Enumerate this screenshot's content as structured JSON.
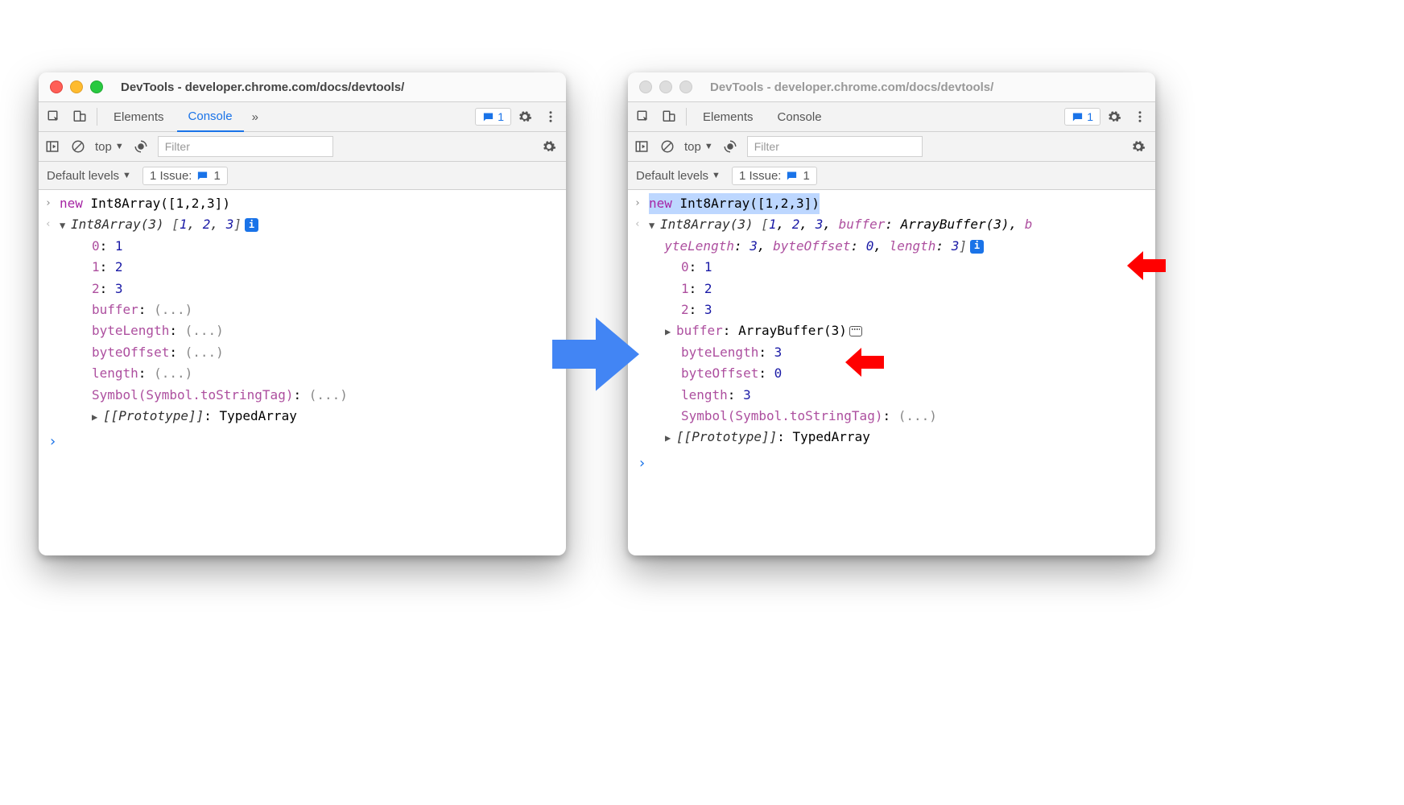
{
  "title": "DevTools - developer.chrome.com/docs/devtools/",
  "tabs": {
    "elements": "Elements",
    "console": "Console",
    "more": "»"
  },
  "badgeCount": "1",
  "subbar": {
    "context": "top",
    "filterPlaceholder": "Filter"
  },
  "issuerow": {
    "levels": "Default levels",
    "issueLabel": "1 Issue:",
    "issueCount": "1"
  },
  "left": {
    "cmd": {
      "keyword": "new",
      "call": "Int8Array",
      "args": "([1,2,3])"
    },
    "preview": {
      "head": "Int8Array(3) ",
      "items": "[1, 2, 3]"
    },
    "props": [
      {
        "k": "0",
        "v": "1",
        "num": true
      },
      {
        "k": "1",
        "v": "2",
        "num": true
      },
      {
        "k": "2",
        "v": "3",
        "num": true
      },
      {
        "k": "buffer",
        "v": "(...)"
      },
      {
        "k": "byteLength",
        "v": "(...)"
      },
      {
        "k": "byteOffset",
        "v": "(...)"
      },
      {
        "k": "length",
        "v": "(...)"
      },
      {
        "k": "Symbol(Symbol.toStringTag)",
        "v": "(...)"
      }
    ],
    "proto": {
      "k": "[[Prototype]]",
      "v": "TypedArray"
    }
  },
  "right": {
    "preview": {
      "head": "Int8Array(3) ",
      "line1": "[1, 2, 3, ",
      "buf_k": "buffer",
      "buf_v": "ArrayBuffer(3)",
      "line2pre": "b",
      "bl_k": "yteLength",
      "bl_v": "3",
      "bo_k": "byteOffset",
      "bo_v": "0",
      "len_k": "length",
      "len_v": "3"
    },
    "props": [
      {
        "k": "0",
        "v": "1",
        "num": true
      },
      {
        "k": "1",
        "v": "2",
        "num": true
      },
      {
        "k": "2",
        "v": "3",
        "num": true
      }
    ],
    "buffer": {
      "k": "buffer",
      "v": "ArrayBuffer(3)"
    },
    "props2": [
      {
        "k": "byteLength",
        "v": "3",
        "num": true
      },
      {
        "k": "byteOffset",
        "v": "0",
        "num": true
      },
      {
        "k": "length",
        "v": "3",
        "num": true
      },
      {
        "k": "Symbol(Symbol.toStringTag)",
        "v": "(...)"
      }
    ],
    "proto": {
      "k": "[[Prototype]]",
      "v": "TypedArray"
    }
  }
}
